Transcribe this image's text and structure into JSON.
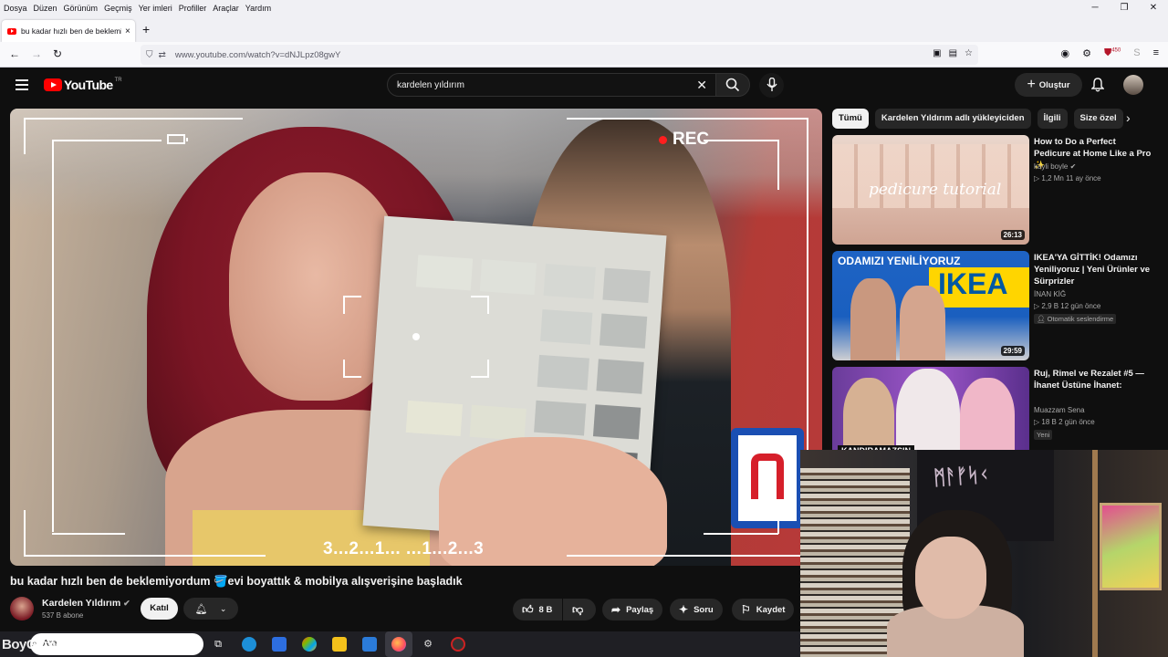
{
  "browser": {
    "menu": [
      "Dosya",
      "Düzen",
      "Görünüm",
      "Geçmiş",
      "Yer imleri",
      "Profiller",
      "Araçlar",
      "Yardım"
    ],
    "tab_title": "bu kadar hızlı ben de beklemiyordum",
    "tab_close": "×",
    "new_tab": "+",
    "url": "www.youtube.com/watch?v=dNJLpz08gwY",
    "ext_badge": "450"
  },
  "youtube": {
    "logo_text": "YouTube",
    "country": "TR",
    "search_query": "kardelen yıldırım",
    "create_label": "Oluştur"
  },
  "player": {
    "rec_label": "REC",
    "countdown": "3...2...1...   ...1...2...3"
  },
  "video": {
    "title": "bu kadar hızlı ben de beklemiyordum 🪣evi boyattık & mobilya alışverişine başladık",
    "channel": "Kardelen Yıldırım",
    "subscribers": "537 B abone",
    "join_label": "Katıl",
    "likes": "8 B",
    "share_label": "Paylaş",
    "ask_label": "Soru",
    "save_label": "Kaydet"
  },
  "sidebar": {
    "chips": [
      "Tümü",
      "Kardelen Yıldırım adlı yükleyiciden",
      "İlgili",
      "Size özel"
    ],
    "items": [
      {
        "title": "How to Do a Perfect Pedicure at Home Like a Pro ✨",
        "channel": "kayli boyle",
        "stats": "1,2 Mn   11 ay önce",
        "duration": "26:13",
        "thumb_text": "pedicure tutorial"
      },
      {
        "title": "IKEA'YA GİTTİK! Odamızı Yeniliyoruz | Yeni Ürünler ve Sürprizler",
        "channel": "İNAN KİĞ",
        "stats": "2,9 B   12 gün önce",
        "duration": "29:59",
        "badge": "Otomatik seslendirme",
        "thumb_top": "ODAMIZI YENİLİYORUZ",
        "thumb_brand": "IKEA"
      },
      {
        "title": "Ruj, Rimel ve Rezalet #5 — İhanet Üstüne İhanet:",
        "channel": "Muazzam Sena",
        "stats": "18 B   2 gün önce",
        "badge": "Yeni",
        "thumb_text": "KANDIRAMAZSIN"
      }
    ]
  },
  "taskbar": {
    "search_placeholder": "Ara"
  },
  "colors": {
    "yt_red": "#ff0000",
    "bg": "#0f0f0f",
    "pill": "#272727"
  }
}
